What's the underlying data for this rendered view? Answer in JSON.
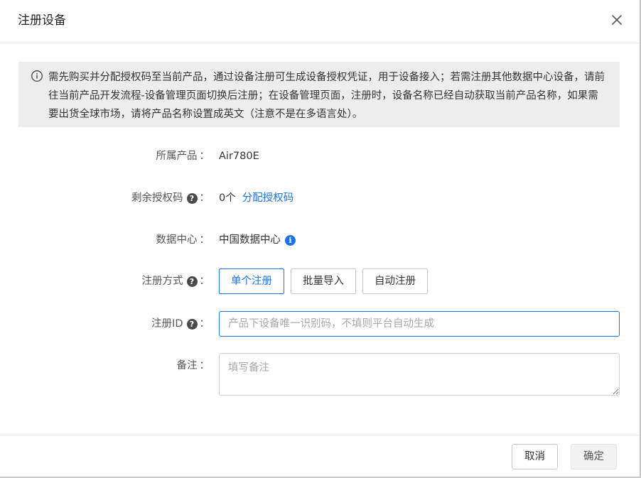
{
  "dialog": {
    "title": "注册设备",
    "close_icon": "close-icon"
  },
  "notice": {
    "icon": "info-circle-icon",
    "text": "需先购买并分配授权码至当前产品，通过设备注册可生成设备授权凭证，用于设备接入；若需注册其他数据中心设备，请前往当前产品开发流程-设备管理页面切换后注册；在设备管理页面，注册时，设备名称已经自动获取当前产品名称，如果需要出货全球市场，请将产品名称设置成英文（注意不是在多语言处）。"
  },
  "form": {
    "product": {
      "label": "所属产品",
      "colon": "：",
      "value": "Air780E"
    },
    "license": {
      "label": "剩余授权码",
      "help": "?",
      "colon": "：",
      "value": "0个",
      "link": "分配授权码"
    },
    "datacenter": {
      "label": "数据中心",
      "colon": "：",
      "value": "中国数据中心",
      "info": "i"
    },
    "method": {
      "label": "注册方式",
      "help": "?",
      "colon": "：",
      "options": [
        "单个注册",
        "批量导入",
        "自动注册"
      ],
      "selected": "单个注册"
    },
    "reg_id": {
      "label": "注册ID",
      "help": "?",
      "colon": "：",
      "value": "",
      "placeholder": "产品下设备唯一识别码，不填则平台自动生成"
    },
    "remark": {
      "label": "备注",
      "colon": "：",
      "value": "",
      "placeholder": "填写备注"
    }
  },
  "footer": {
    "cancel_label": "取消",
    "confirm_label": "确定"
  },
  "colors": {
    "accent": "#1a73e8",
    "notice_bg": "#ededed",
    "help_icon_bg": "#4a4a4a"
  }
}
